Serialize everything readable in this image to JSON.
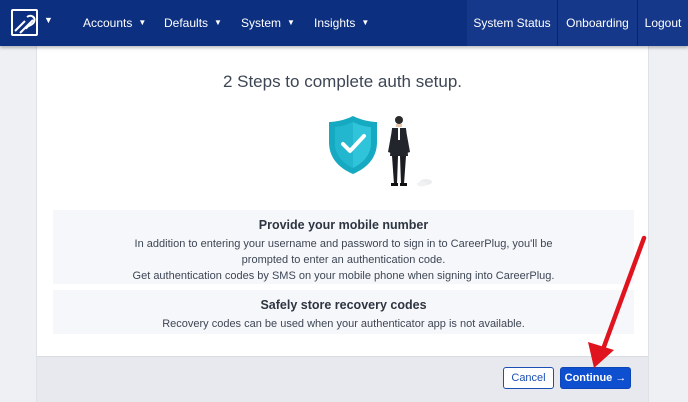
{
  "navbar": {
    "menus": [
      {
        "label": "Accounts"
      },
      {
        "label": "Defaults"
      },
      {
        "label": "System"
      },
      {
        "label": "Insights"
      }
    ],
    "right": [
      {
        "label": "System Status"
      },
      {
        "label": "Onboarding"
      },
      {
        "label": "Logout"
      }
    ]
  },
  "page": {
    "title": "2 Steps to complete auth setup."
  },
  "steps": [
    {
      "title": "Provide your mobile number",
      "lines": [
        "In addition to entering your username and password to sign in to CareerPlug, you'll be",
        "prompted to enter an authentication code.",
        "Get authentication codes by SMS on your mobile phone when signing into CareerPlug."
      ]
    },
    {
      "title": "Safely store recovery codes",
      "lines": [
        "Recovery codes can be used when your authenticator app is not available."
      ]
    }
  ],
  "footer": {
    "cancel_label": "Cancel",
    "continue_label": "Continue →"
  },
  "colors": {
    "navbar": "#0d2f80",
    "primary": "#0d4fcf",
    "shield": "#17b0c9",
    "annotation_arrow": "#e0141e"
  }
}
